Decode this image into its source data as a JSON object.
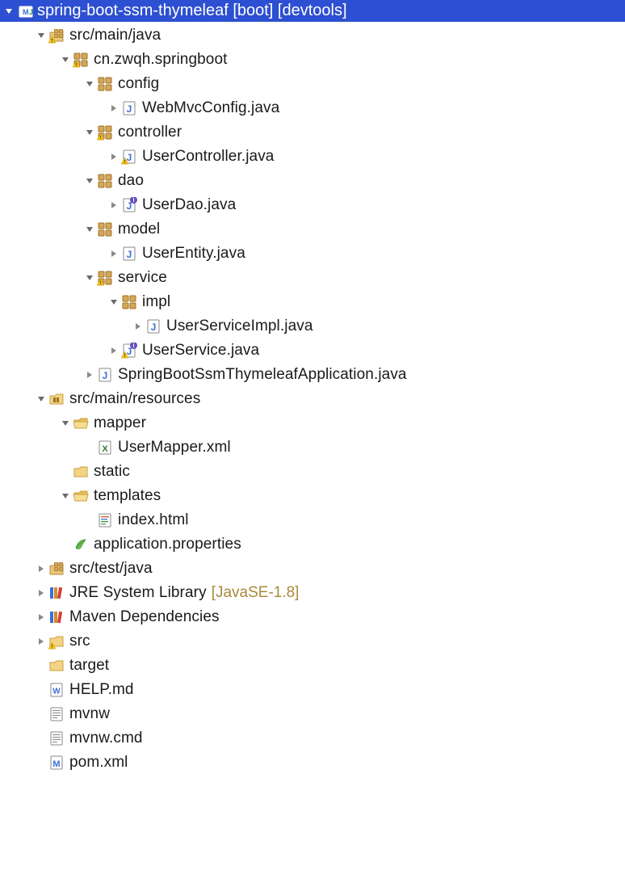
{
  "project": {
    "name": "spring-boot-ssm-thymeleaf",
    "tags": "[boot] [devtools]"
  },
  "tree": [
    {
      "indent": 0,
      "arrow": "down",
      "icon": "pkgfolder-warn",
      "label": "src/main/java"
    },
    {
      "indent": 1,
      "arrow": "down",
      "icon": "package-warn",
      "label": "cn.zwqh.springboot"
    },
    {
      "indent": 2,
      "arrow": "down",
      "icon": "package",
      "label": "config"
    },
    {
      "indent": 3,
      "arrow": "right",
      "icon": "java",
      "label": "WebMvcConfig.java"
    },
    {
      "indent": 2,
      "arrow": "down",
      "icon": "package-warn",
      "label": "controller"
    },
    {
      "indent": 3,
      "arrow": "right",
      "icon": "java-warn",
      "label": "UserController.java"
    },
    {
      "indent": 2,
      "arrow": "down",
      "icon": "package",
      "label": "dao"
    },
    {
      "indent": 3,
      "arrow": "right",
      "icon": "java-int",
      "label": "UserDao.java"
    },
    {
      "indent": 2,
      "arrow": "down",
      "icon": "package",
      "label": "model"
    },
    {
      "indent": 3,
      "arrow": "right",
      "icon": "java",
      "label": "UserEntity.java"
    },
    {
      "indent": 2,
      "arrow": "down",
      "icon": "package-warn",
      "label": "service"
    },
    {
      "indent": 3,
      "arrow": "down",
      "icon": "package",
      "label": "impl"
    },
    {
      "indent": 4,
      "arrow": "right",
      "icon": "java",
      "label": "UserServiceImpl.java"
    },
    {
      "indent": 3,
      "arrow": "right",
      "icon": "java-warn-int",
      "label": "UserService.java"
    },
    {
      "indent": 2,
      "arrow": "right",
      "icon": "java",
      "label": "SpringBootSsmThymeleafApplication.java"
    },
    {
      "indent": 0,
      "arrow": "down",
      "icon": "res-folder",
      "label": "src/main/resources"
    },
    {
      "indent": 1,
      "arrow": "down",
      "icon": "folder-open",
      "label": "mapper"
    },
    {
      "indent": 2,
      "arrow": "none",
      "icon": "xml",
      "label": "UserMapper.xml"
    },
    {
      "indent": 1,
      "arrow": "none",
      "icon": "folder",
      "label": "static"
    },
    {
      "indent": 1,
      "arrow": "down",
      "icon": "folder-open",
      "label": "templates"
    },
    {
      "indent": 2,
      "arrow": "none",
      "icon": "html",
      "label": "index.html"
    },
    {
      "indent": 1,
      "arrow": "none",
      "icon": "properties",
      "label": "application.properties"
    },
    {
      "indent": 0,
      "arrow": "right",
      "icon": "pkgfolder",
      "label": "src/test/java"
    },
    {
      "indent": 0,
      "arrow": "right",
      "icon": "library",
      "label": "JRE System Library",
      "suffix": "[JavaSE-1.8]"
    },
    {
      "indent": 0,
      "arrow": "right",
      "icon": "library",
      "label": "Maven Dependencies"
    },
    {
      "indent": 0,
      "arrow": "right",
      "icon": "folder-warn",
      "label": "src"
    },
    {
      "indent": 0,
      "arrow": "none",
      "icon": "folder",
      "label": "target"
    },
    {
      "indent": 0,
      "arrow": "none",
      "icon": "md",
      "label": "HELP.md"
    },
    {
      "indent": 0,
      "arrow": "none",
      "icon": "text",
      "label": "mvnw"
    },
    {
      "indent": 0,
      "arrow": "none",
      "icon": "text",
      "label": "mvnw.cmd"
    },
    {
      "indent": 0,
      "arrow": "none",
      "icon": "maven",
      "label": "pom.xml"
    }
  ]
}
